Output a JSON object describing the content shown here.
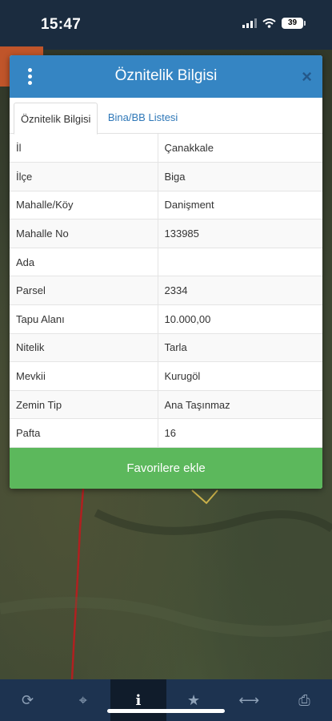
{
  "status_bar": {
    "time": "15:47",
    "battery": "39"
  },
  "dialog": {
    "title": "Öznitelik Bilgisi",
    "close": "×",
    "tabs": [
      {
        "label": "Öznitelik Bilgisi",
        "active": true
      },
      {
        "label": "Bina/BB Listesi",
        "active": false
      }
    ],
    "rows": [
      {
        "label": "İl",
        "value": "Çanakkale"
      },
      {
        "label": "İlçe",
        "value": "Biga"
      },
      {
        "label": "Mahalle/Köy",
        "value": "Danişment"
      },
      {
        "label": "Mahalle No",
        "value": "133985"
      },
      {
        "label": "Ada",
        "value": ""
      },
      {
        "label": "Parsel",
        "value": "2334"
      },
      {
        "label": "Tapu Alanı",
        "value": "10.000,00"
      },
      {
        "label": "Nitelik",
        "value": "Tarla"
      },
      {
        "label": "Mevkii",
        "value": "Kurugöl"
      },
      {
        "label": "Zemin Tip",
        "value": "Ana Taşınmaz"
      },
      {
        "label": "Pafta",
        "value": "16"
      }
    ],
    "favorite_button": "Favorilere ekle"
  },
  "bottom_nav": [
    {
      "icon": "refresh-icon",
      "glyph": "⟳",
      "active": false
    },
    {
      "icon": "crosshair-icon",
      "glyph": "⌖",
      "active": false
    },
    {
      "icon": "info-icon",
      "glyph": "i",
      "active": true
    },
    {
      "icon": "star-icon",
      "glyph": "★",
      "active": false
    },
    {
      "icon": "measure-icon",
      "glyph": "⟷",
      "active": false
    },
    {
      "icon": "print-icon",
      "glyph": "⎙",
      "active": false
    }
  ],
  "colors": {
    "header": "#3585c3",
    "status_bar": "#1b2c3f",
    "favorite_button": "#5cb85c",
    "bottom_nav": "#1d3350",
    "parcel_outline": "#c9b04a",
    "boundary_line": "#b02020"
  }
}
